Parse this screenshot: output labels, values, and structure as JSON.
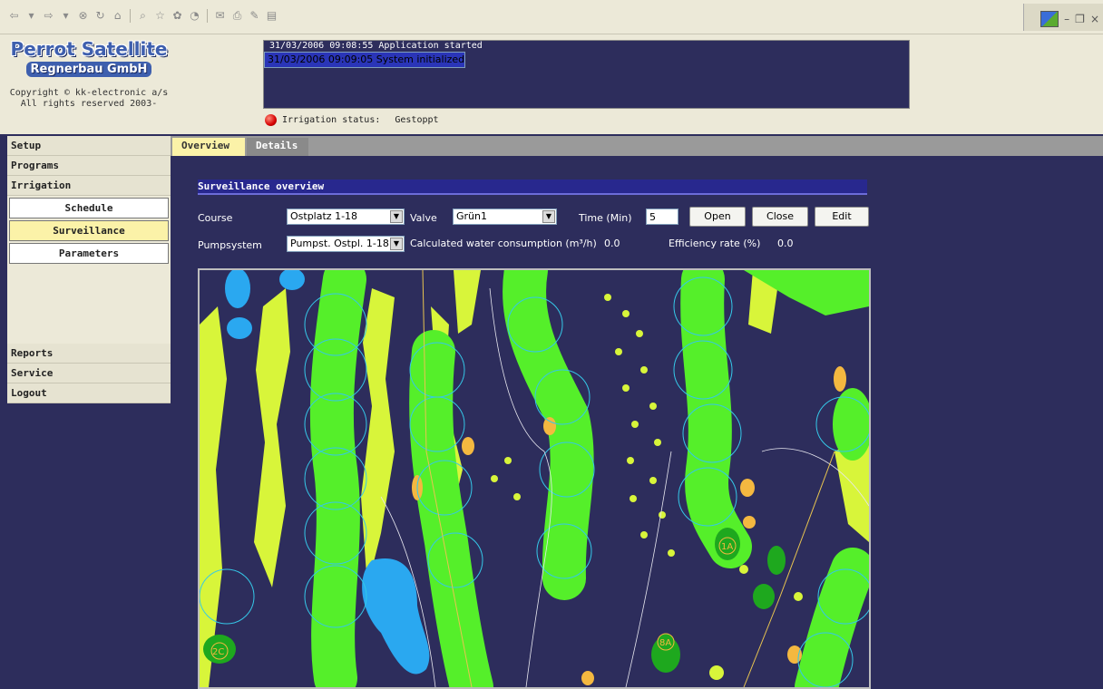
{
  "browser": {
    "toolbar_icons": [
      "back-icon",
      "dropdown-icon",
      "forward-icon",
      "dropdown-icon",
      "stop-icon",
      "refresh-icon",
      "home-icon",
      "search-icon",
      "favorites-icon",
      "media-icon",
      "history-icon",
      "mail-icon",
      "print-icon",
      "edit-icon",
      "discuss-icon"
    ],
    "window_controls": [
      "minimize-icon",
      "restore-icon",
      "close-icon"
    ]
  },
  "header": {
    "logo_line1": "Perrot Satellite",
    "logo_line2": "Regnerbau GmbH",
    "copyright_line1": "Copyright © kk-electronic a/s",
    "copyright_line2": "All rights reserved 2003-",
    "log": [
      {
        "text": "31/03/2006 09:08:55 Application started",
        "selected": false
      },
      {
        "text": "31/03/2006 09:09:05 System initialized",
        "selected": true
      }
    ],
    "status_label": "Irrigation status:",
    "status_value": "Gestoppt",
    "status_color": "#d60000"
  },
  "nav": {
    "setup": "Setup",
    "programs": "Programs",
    "irrigation": "Irrigation",
    "schedule": "Schedule",
    "surveillance": "Surveillance",
    "parameters": "Parameters",
    "reports": "Reports",
    "service": "Service",
    "logout": "Logout"
  },
  "tabs": {
    "overview": "Overview",
    "details": "Details"
  },
  "main": {
    "section_title": "Surveillance overview",
    "course_label": "Course",
    "course_value": "Ostplatz 1-18",
    "valve_label": "Valve",
    "valve_value": "Grün1",
    "time_label": "Time (Min)",
    "time_value": "5",
    "open_button": "Open",
    "close_button": "Close",
    "edit_button": "Edit",
    "pumpsystem_label": "Pumpsystem",
    "pumpsystem_value": "Pumpst. Ostpl. 1-18",
    "consumption_label": "Calculated water consumption (m³/h)",
    "consumption_value": "0.0",
    "efficiency_label": "Efficiency rate (%)",
    "efficiency_value": "0.0"
  },
  "map": {
    "labels": [
      "1A",
      "2C",
      "8A"
    ],
    "colors": {
      "background": "#2d2d5c",
      "fairway": "#55ef2a",
      "rough": "#d8f53a",
      "water": "#2aa8f0",
      "bunker": "#f4b840",
      "tee": "#1ea81e",
      "sprinkler_circle": "#35c8e8"
    }
  }
}
